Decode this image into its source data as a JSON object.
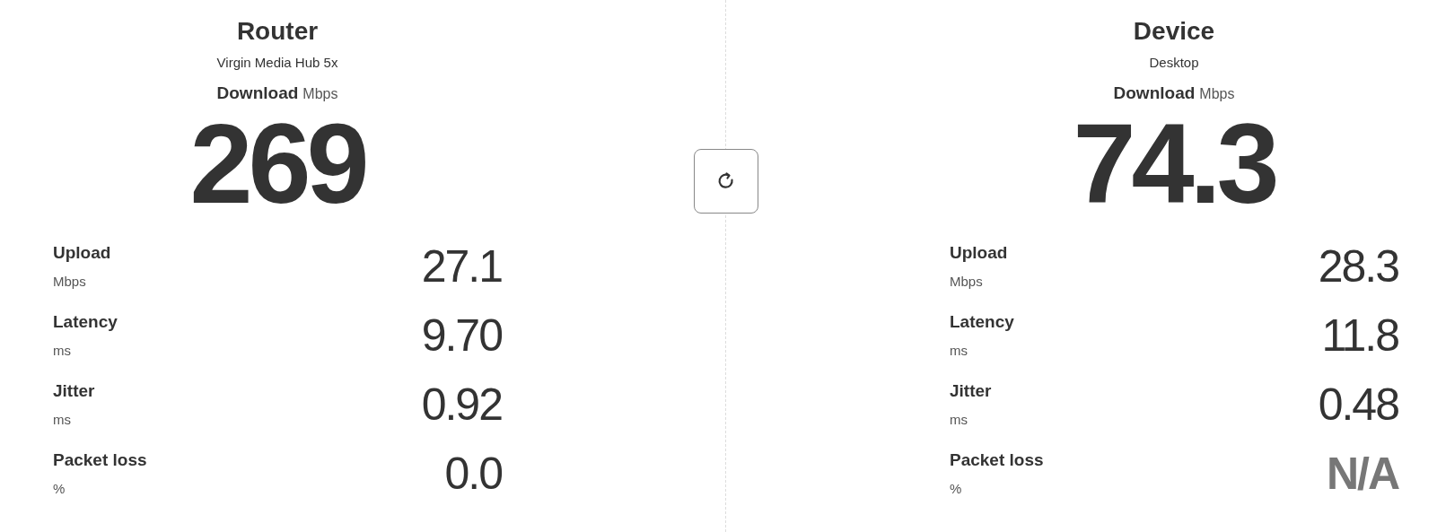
{
  "panels": [
    {
      "title": "Router",
      "subtitle": "Virgin Media Hub 5x",
      "download": {
        "label": "Download",
        "unit": "Mbps",
        "value": "269"
      },
      "metrics": [
        {
          "label": "Upload",
          "unit": "Mbps",
          "value": "27.1",
          "unavailable": false
        },
        {
          "label": "Latency",
          "unit": "ms",
          "value": "9.70",
          "unavailable": false
        },
        {
          "label": "Jitter",
          "unit": "ms",
          "value": "0.92",
          "unavailable": false
        },
        {
          "label": "Packet loss",
          "unit": "%",
          "value": "0.0",
          "unavailable": false
        }
      ]
    },
    {
      "title": "Device",
      "subtitle": "Desktop",
      "download": {
        "label": "Download",
        "unit": "Mbps",
        "value": "74.3"
      },
      "metrics": [
        {
          "label": "Upload",
          "unit": "Mbps",
          "value": "28.3",
          "unavailable": false
        },
        {
          "label": "Latency",
          "unit": "ms",
          "value": "11.8",
          "unavailable": false
        },
        {
          "label": "Jitter",
          "unit": "ms",
          "value": "0.48",
          "unavailable": false
        },
        {
          "label": "Packet loss",
          "unit": "%",
          "value": "N/A",
          "unavailable": true
        }
      ]
    }
  ]
}
